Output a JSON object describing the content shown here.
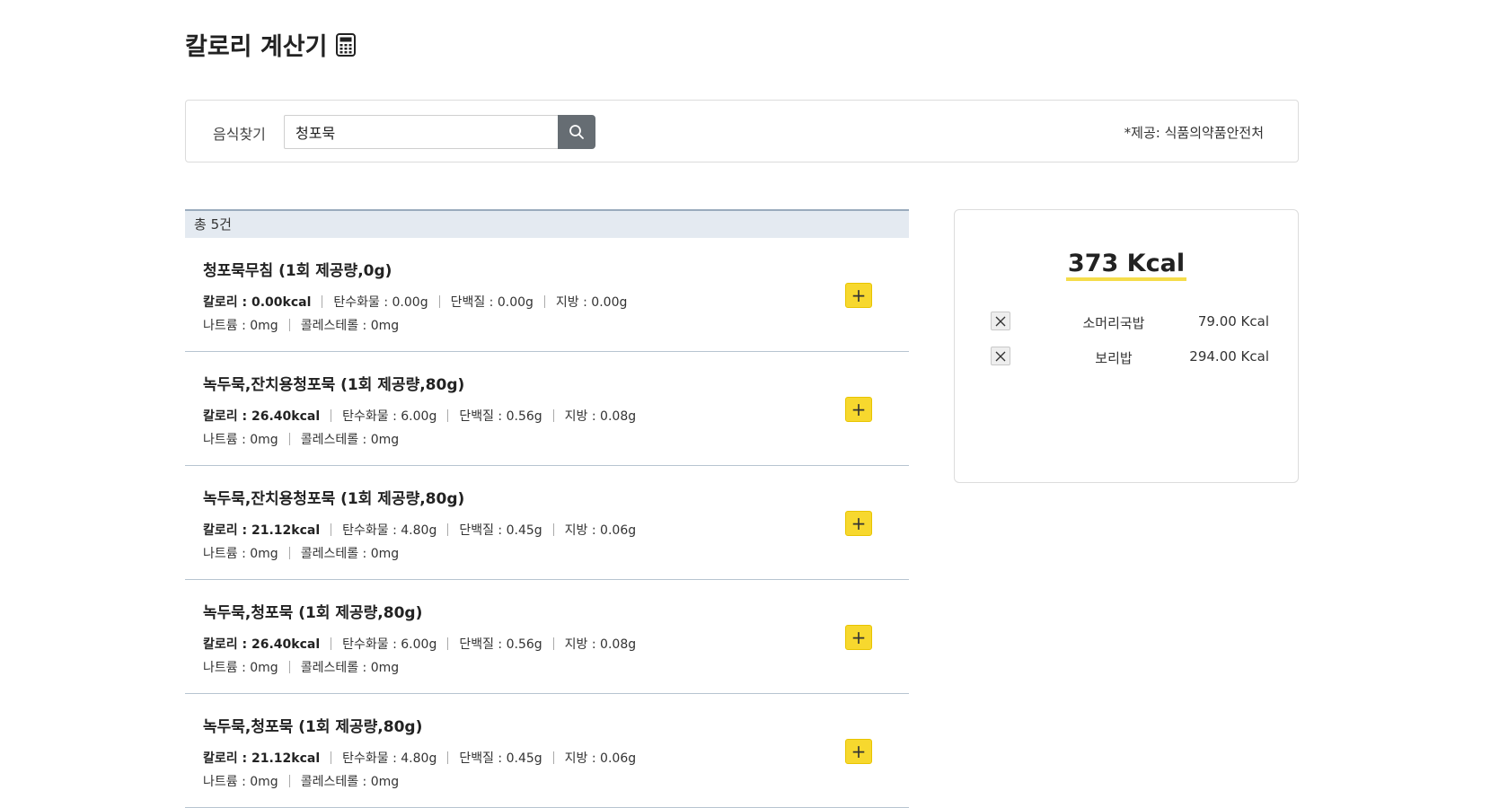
{
  "header": {
    "title": "칼로리 계산기",
    "title_icon": "calculator-icon"
  },
  "search": {
    "label": "음식찾기",
    "value": "청포묵",
    "provider": "*제공: 식품의약품안전처",
    "button_icon": "search-icon",
    "button_color": "#666d73"
  },
  "results": {
    "total_label": "총 5건",
    "items": [
      {
        "name": "청포묵무침 (1회 제공량,0g)",
        "calorie": "칼로리 : 0.00kcal",
        "carbs": "탄수화물 : 0.00g",
        "protein": "단백질 : 0.00g",
        "fat": "지방 : 0.00g",
        "sodium": "나트륨 : 0mg",
        "cholesterol": "콜레스테롤 : 0mg"
      },
      {
        "name": "녹두묵,잔치용청포묵 (1회 제공량,80g)",
        "calorie": "칼로리 : 26.40kcal",
        "carbs": "탄수화물 : 6.00g",
        "protein": "단백질 : 0.56g",
        "fat": "지방 : 0.08g",
        "sodium": "나트륨 : 0mg",
        "cholesterol": "콜레스테롤 : 0mg"
      },
      {
        "name": "녹두묵,잔치용청포묵 (1회 제공량,80g)",
        "calorie": "칼로리 : 21.12kcal",
        "carbs": "탄수화물 : 4.80g",
        "protein": "단백질 : 0.45g",
        "fat": "지방 : 0.06g",
        "sodium": "나트륨 : 0mg",
        "cholesterol": "콜레스테롤 : 0mg"
      },
      {
        "name": "녹두묵,청포묵 (1회 제공량,80g)",
        "calorie": "칼로리 : 26.40kcal",
        "carbs": "탄수화물 : 6.00g",
        "protein": "단백질 : 0.56g",
        "fat": "지방 : 0.08g",
        "sodium": "나트륨 : 0mg",
        "cholesterol": "콜레스테롤 : 0mg"
      },
      {
        "name": "녹두묵,청포묵 (1회 제공량,80g)",
        "calorie": "칼로리 : 21.12kcal",
        "carbs": "탄수화물 : 4.80g",
        "protein": "단백질 : 0.45g",
        "fat": "지방 : 0.06g",
        "sodium": "나트륨 : 0mg",
        "cholesterol": "콜레스테롤 : 0mg"
      }
    ],
    "add_label": "+",
    "add_color": "#f7d82e"
  },
  "summary": {
    "total": "373 Kcal",
    "selected": [
      {
        "name": "소머리국밥",
        "kcal": "79.00 Kcal"
      },
      {
        "name": "보리밥",
        "kcal": "294.00 Kcal"
      }
    ],
    "remove_icon": "close-icon",
    "underline_color": "#f5dc4a"
  }
}
